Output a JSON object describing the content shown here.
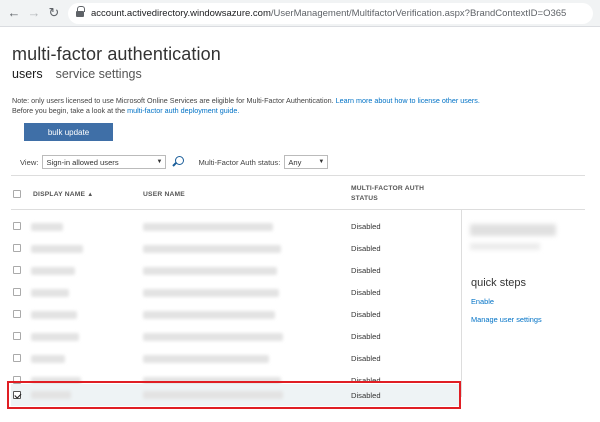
{
  "browser": {
    "url_host": "account.activedirectory.windowsazure.com",
    "url_path": "/UserManagement/MultifactorVerification.aspx?BrandContextID=O365"
  },
  "page": {
    "title": "multi-factor authentication",
    "tabs": [
      {
        "label": "users",
        "active": true
      },
      {
        "label": "service settings",
        "active": false
      }
    ],
    "note": {
      "line1_text": "Note: only users licensed to use Microsoft Online Services are eligible for Multi-Factor Authentication.",
      "line1_link": "Learn more about how to license other users.",
      "line2_text": "Before you begin, take a look at the",
      "line2_link": "multi-factor auth deployment guide."
    },
    "bulk_update_label": "bulk update",
    "filters": {
      "view_label": "View:",
      "view_value": "Sign-in allowed users",
      "mfa_label": "Multi-Factor Auth status:",
      "mfa_value": "Any"
    }
  },
  "table": {
    "columns": {
      "display_name": "DISPLAY NAME",
      "user_name": "USER NAME",
      "mfa_status_line1": "MULTI-FACTOR AUTH",
      "mfa_status_line2": "STATUS"
    },
    "sort_indicator": "▲",
    "rows": [
      {
        "status": "Disabled",
        "checked": false
      },
      {
        "status": "Disabled",
        "checked": false
      },
      {
        "status": "Disabled",
        "checked": false
      },
      {
        "status": "Disabled",
        "checked": false
      },
      {
        "status": "Disabled",
        "checked": false
      },
      {
        "status": "Disabled",
        "checked": false
      },
      {
        "status": "Disabled",
        "checked": false
      },
      {
        "status": "Disabled",
        "checked": false
      },
      {
        "status": "Disabled",
        "checked": true
      }
    ]
  },
  "side_pane": {
    "quick_steps_title": "quick steps",
    "links": [
      "Enable",
      "Manage user settings"
    ]
  },
  "colors": {
    "accent": "#3f6fa7",
    "link": "#0072c6",
    "highlight": "#e01e24"
  },
  "icons": [
    "back-arrow-icon",
    "forward-arrow-icon",
    "reload-icon",
    "lock-icon",
    "search-icon",
    "chevron-down-icon",
    "sort-ascending-icon",
    "checkmark-icon"
  ]
}
